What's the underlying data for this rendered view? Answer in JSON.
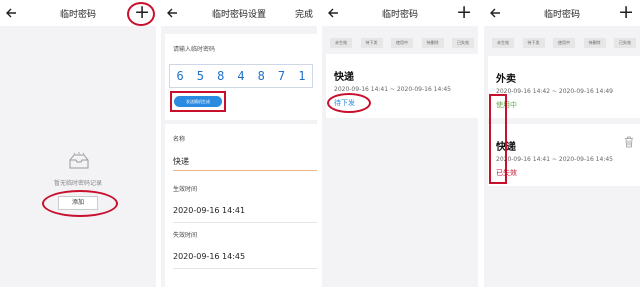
{
  "screen1": {
    "title": "临时密码",
    "add_icon": "plus-icon",
    "empty_text": "暂无临时密码记录",
    "add_button": "添加"
  },
  "screen2": {
    "title": "临时密码设置",
    "done_label": "完成",
    "password_hint": "请输入临时密码",
    "digits": [
      "6",
      "5",
      "8",
      "4",
      "8",
      "7",
      "1"
    ],
    "send_button": "发送随机生成",
    "name_label": "名称",
    "name_value": "快递",
    "start_label": "生效时间",
    "start_value": "2020-09-16 14:41",
    "end_label": "失效时间",
    "end_value": "2020-09-16 14:45"
  },
  "screen3": {
    "title": "临时密码",
    "chips": [
      "未生效",
      "待下发",
      "使用中",
      "待删除",
      "已失效"
    ],
    "item": {
      "name": "快递",
      "time_range": "2020-09-16 14:41 ~ 2020-09-16 14:45",
      "status": "待下发"
    }
  },
  "screen4": {
    "title": "临时密码",
    "chips": [
      "未生效",
      "待下发",
      "使用中",
      "待删除",
      "已失效"
    ],
    "items": [
      {
        "name": "外卖",
        "time_range": "2020-09-16 14:42 ~ 2020-09-16 14:49",
        "status": "使用中"
      },
      {
        "name": "快递",
        "time_range": "2020-09-16 14:41 ~ 2020-09-16 14:45",
        "status": "已失效"
      }
    ]
  },
  "colors": {
    "annotation": "#c8102e",
    "digit_blue": "#1f6fc5",
    "button_blue": "#2a8be0",
    "status_pending": "#2a8be0",
    "status_active": "#6aa84f",
    "status_expired": "#c8102e"
  }
}
